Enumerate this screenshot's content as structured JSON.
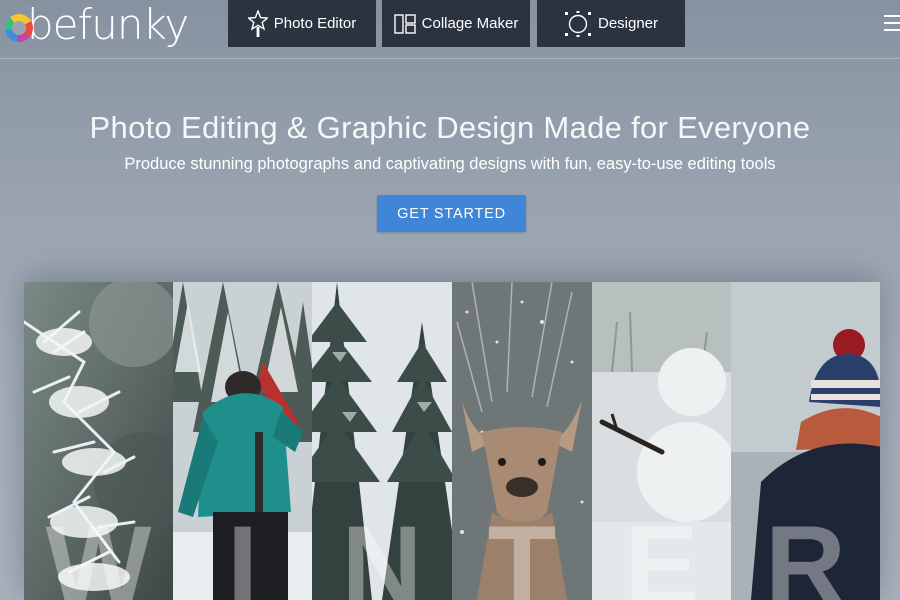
{
  "header": {
    "logo_text": "befunky",
    "tabs": [
      {
        "label": "Photo Editor",
        "icon": "star-wand-icon"
      },
      {
        "label": "Collage Maker",
        "icon": "collage-grid-icon"
      },
      {
        "label": "Designer",
        "icon": "designer-circle-icon"
      }
    ],
    "menu_icon": "hamburger-menu-icon"
  },
  "hero": {
    "title": "Photo Editing & Graphic Design Made for Everyone",
    "subtitle": "Produce stunning photographs and captivating designs with fun, easy-to-use editing tools",
    "cta_label": "GET STARTED"
  },
  "collage": {
    "letters": [
      "W",
      "I",
      "N",
      "T",
      "E",
      "R"
    ]
  },
  "colors": {
    "tab_bg": "#2b3340",
    "cta_bg": "#3f86d8",
    "page_bg": "#9aa4b1"
  }
}
